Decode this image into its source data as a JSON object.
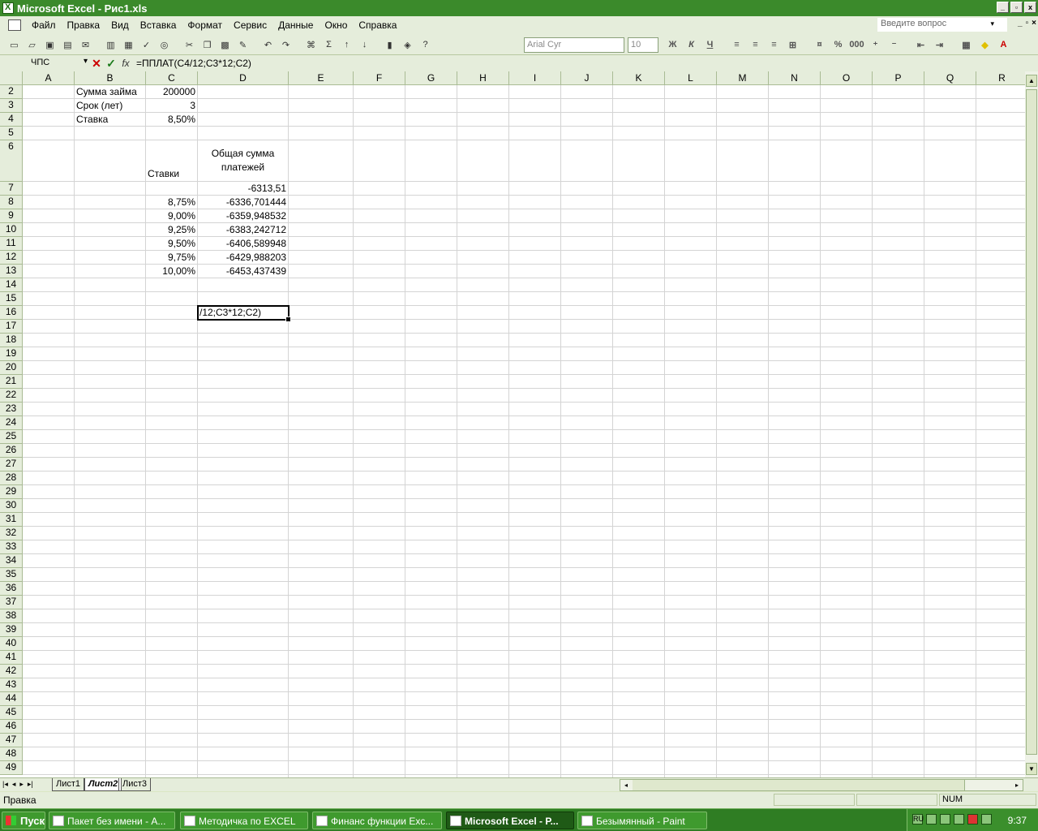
{
  "window": {
    "title": "Microsoft Excel - Рис1.xls",
    "min_label": "_",
    "max_label": "▫",
    "close_label": "x"
  },
  "menu": {
    "items": [
      "Файл",
      "Правка",
      "Вид",
      "Вставка",
      "Формат",
      "Сервис",
      "Данные",
      "Окно",
      "Справка"
    ],
    "ask_placeholder": "Введите вопрос"
  },
  "toolbar": {
    "font_name": "Arial Cyr",
    "font_size": "10",
    "bold": "Ж",
    "italic": "К",
    "underline": "Ч",
    "percent": "%",
    "thousands": "000"
  },
  "formula_bar": {
    "name_box": "ЧПС",
    "fx": "fx",
    "formula": "=ППЛАТ(C4/12;C3*12;C2)"
  },
  "columns": [
    "A",
    "B",
    "C",
    "D",
    "E",
    "F",
    "G",
    "H",
    "I",
    "J",
    "K",
    "L",
    "M",
    "N",
    "O",
    "P",
    "Q",
    "R"
  ],
  "rows": [
    "2",
    "3",
    "4",
    "5",
    "6",
    "7",
    "8",
    "9",
    "10",
    "11",
    "12",
    "13",
    "14",
    "15",
    "16",
    "17",
    "18",
    "19",
    "20",
    "21",
    "22",
    "23",
    "24",
    "25",
    "26",
    "27",
    "28",
    "29",
    "30",
    "31",
    "32",
    "33",
    "34",
    "35",
    "36",
    "37",
    "38",
    "39",
    "40",
    "41",
    "42",
    "43",
    "44",
    "45",
    "46",
    "47",
    "48",
    "49"
  ],
  "cells": {
    "b2": "Сумма займа",
    "c2": "200000",
    "b3": "Срок (лет)",
    "c3": "3",
    "b4": "Ставка",
    "c4": "8,50%",
    "c6": "Ставки",
    "d6": "Общая сумма платежей",
    "d7": "-6313,51",
    "c8": "8,75%",
    "d8": "-6336,701444",
    "c9": "9,00%",
    "d9": "-6359,948532",
    "c10": "9,25%",
    "d10": "-6383,242712",
    "c11": "9,50%",
    "d11": "-6406,589948",
    "c12": "9,75%",
    "d12": "-6429,988203",
    "c13": "10,00%",
    "d13": "-6453,437439",
    "d16": "/12;C3*12;C2)"
  },
  "sheets": [
    "Лист1",
    "Лист2",
    "Лист3"
  ],
  "active_sheet": "Лист2",
  "status": {
    "mode": "Правка",
    "num": "NUM"
  },
  "taskbar": {
    "start": "Пуск",
    "tasks": [
      "Пакет без имени - A...",
      "Методичка по EXCEL",
      "Финанс функции Exc...",
      "Microsoft Excel - Р...",
      "Безымянный - Paint"
    ],
    "lang": "RU",
    "clock": "9:37"
  },
  "colors": {
    "title_bar": "#3b8a2b",
    "header_bg": "#e5eddb",
    "taskbar": "#2f7d23"
  }
}
